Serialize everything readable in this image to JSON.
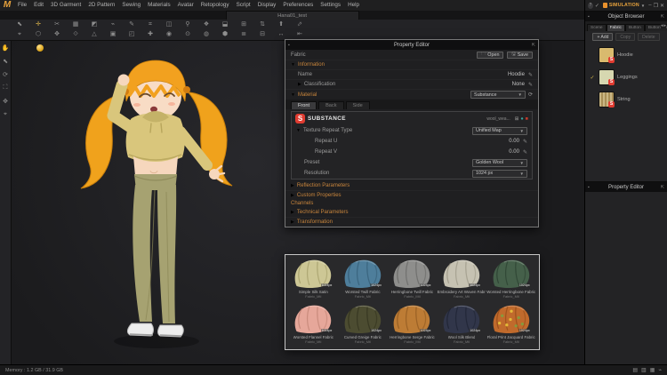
{
  "app": {
    "logo": "M",
    "doc_tab": "Hana01_test"
  },
  "menubar": {
    "items": [
      "File",
      "Edit",
      "3D Garment",
      "2D Pattern",
      "Sewing",
      "Materials",
      "Avatar",
      "Retopology",
      "Script",
      "Display",
      "Preferences",
      "Settings",
      "Help"
    ]
  },
  "toolbar": {
    "row1": [
      {
        "n": "select-tool-icon",
        "g": "⬉"
      },
      {
        "n": "move-tool-icon",
        "g": "✛",
        "gold": true
      },
      {
        "n": "scissors-tool-icon",
        "g": "✂"
      },
      {
        "n": "pattern-grid-icon",
        "g": "▦"
      },
      {
        "n": "pin-tool-icon",
        "g": "◩"
      },
      {
        "n": "sewing-tool-icon",
        "g": "⌁"
      },
      {
        "n": "edit-tool-icon",
        "g": "✎"
      },
      {
        "n": "measure-tool-icon",
        "g": "⌗"
      },
      {
        "n": "panel-tool-icon",
        "g": "◫"
      },
      {
        "n": "magnet-tool-icon",
        "g": "⚲"
      },
      {
        "n": "layout-tool-icon",
        "g": "❖"
      },
      {
        "n": "mirror-tool-icon",
        "g": "⬓"
      },
      {
        "n": "sync-tool-icon",
        "g": "⊞"
      },
      {
        "n": "swap-tool-icon",
        "g": "⇅"
      },
      {
        "n": "arrange-tool-icon",
        "g": "⬆"
      },
      {
        "n": "flip-tool-icon",
        "g": "⬀"
      }
    ],
    "row2": [
      {
        "n": "target-tool-icon",
        "g": "⌖"
      },
      {
        "n": "hexagon-tool-icon",
        "g": "⬡"
      },
      {
        "n": "gizmo-tool-icon",
        "g": "✥"
      },
      {
        "n": "diamond-tool-icon",
        "g": "⟐"
      },
      {
        "n": "triangle-tool-icon",
        "g": "△"
      },
      {
        "n": "board-tool-icon",
        "g": "▣"
      },
      {
        "n": "frame-tool-icon",
        "g": "◰"
      },
      {
        "n": "add-tool-icon",
        "g": "✚"
      },
      {
        "n": "record-tool-icon",
        "g": "◉"
      },
      {
        "n": "eye-tool-icon",
        "g": "⊙"
      },
      {
        "n": "sphere-tool-icon",
        "g": "◍"
      },
      {
        "n": "hex-fill-tool-icon",
        "g": "⬢"
      },
      {
        "n": "list-tool-icon",
        "g": "≣"
      },
      {
        "n": "collapse-tool-icon",
        "g": "⊟"
      },
      {
        "n": "horizontal-tool-icon",
        "g": "↔"
      },
      {
        "n": "end-tool-icon",
        "g": "⇤"
      }
    ]
  },
  "left_toolbar": {
    "items": [
      {
        "n": "pan-hand-icon",
        "g": "✋"
      },
      {
        "n": "select-arrow-icon",
        "g": "⬉"
      },
      {
        "n": "rotate-view-icon",
        "g": "⟳"
      },
      {
        "n": "frame-view-icon",
        "g": "⛶"
      },
      {
        "n": "move-all-icon",
        "g": "✥"
      },
      {
        "n": "focus-target-icon",
        "g": "⌖"
      }
    ]
  },
  "property_editor": {
    "title": "Property Editor",
    "fabric_label": "Fabric",
    "open_label": "Open",
    "save_label": "Save",
    "info_header": "Information",
    "name_label": "Name",
    "name_value": "Hoodie",
    "class_label": "Classification",
    "class_value": "None",
    "material_header": "Material",
    "material_value": "Substance",
    "tabs": [
      "Front",
      "Back",
      "Side"
    ],
    "sub_brand": "SUBSTANCE",
    "sub_file": "wool_wea...",
    "repeat_type_label": "Texture Repeat Type",
    "repeat_type_value": "Unified Map",
    "repeat_u_label": "Repeat U",
    "repeat_u_value": "0.00",
    "repeat_v_label": "Repeat V",
    "repeat_v_value": "0.00",
    "preset_label": "Preset",
    "preset_value": "Golden Wool",
    "res_label": "Resolution",
    "res_value": "1024 px",
    "collapsed1": [
      "Reflection Parameters",
      "Custom Properties"
    ],
    "channels_header": "Channels",
    "collapsed2": [
      "Technical Parameters",
      "Transformation"
    ]
  },
  "gallery": {
    "tag": "1024px",
    "items": [
      {
        "name": "Simple Silk Satin",
        "sub": "Fabric_Mtl",
        "color": "#cdc795",
        "shade": "#9b9560"
      },
      {
        "name": "Worsted Twill Fabric",
        "sub": "Fabric_Mtl",
        "color": "#4e7e9b",
        "shade": "#2f566e"
      },
      {
        "name": "Herringbone Twill Fabric",
        "sub": "Fabric_Mtl",
        "color": "#8e8e8c",
        "shade": "#5f5f5d"
      },
      {
        "name": "Embroidery Art Woven Fabric",
        "sub": "Fabric_Mtl",
        "color": "#c6c2b2",
        "shade": "#948f7e"
      },
      {
        "name": "Worsted Herringbone Fabric",
        "sub": "Fabric_Mtl",
        "color": "#45604a",
        "shade": "#273a2c"
      },
      {
        "name": "Worsted Flannel Fabric",
        "sub": "Fabric_Mtl",
        "color": "#e6a79a",
        "shade": "#b97b6c"
      },
      {
        "name": "Curved Greige Fabric",
        "sub": "Fabric_Mtl",
        "color": "#4c4c31",
        "shade": "#2d2d1a"
      },
      {
        "name": "Herringbone Serge Fabric",
        "sub": "Fabric_Mtl",
        "color": "#bd7c35",
        "shade": "#86521c"
      },
      {
        "name": "Wool Silk Blend",
        "sub": "Fabric_Mtl",
        "color": "#31364a",
        "shade": "#1b1f2e"
      },
      {
        "name": "Floral Print Jacquard Fabric",
        "sub": "Fabric_Mtl",
        "color": "#c06a2c",
        "shade": "#8a4514",
        "floral": true
      }
    ]
  },
  "sidebar": {
    "sim_label": "SIMULATION",
    "ob_title": "Object Browser",
    "tabs": [
      {
        "label": "Scene",
        "active": false
      },
      {
        "label": "Fabric",
        "active": true
      },
      {
        "label": "Button",
        "active": false
      },
      {
        "label": "Buttonhole",
        "active": false
      }
    ],
    "add_label": "+ Add",
    "copy_label": "Copy",
    "delete_label": "Delete",
    "items": [
      {
        "label": "Hoodie",
        "color": "#d9ba6e",
        "checked": false,
        "striped": false
      },
      {
        "label": "Leggings",
        "color": "#d6d7b0",
        "checked": true,
        "striped": false
      },
      {
        "label": "String",
        "color": "#c9b684",
        "checked": false,
        "striped": true
      }
    ],
    "pe2_title": "Property Editor"
  },
  "statusbar": {
    "left_text": "Memory : 1.2 GB / 31.9 GB",
    "icons": [
      {
        "n": "layout-single-icon",
        "g": "▤"
      },
      {
        "n": "layout-split-icon",
        "g": "▥"
      },
      {
        "n": "layout-grid-icon",
        "g": "▦"
      },
      {
        "n": "plugin-icon",
        "g": "⌁"
      }
    ]
  }
}
